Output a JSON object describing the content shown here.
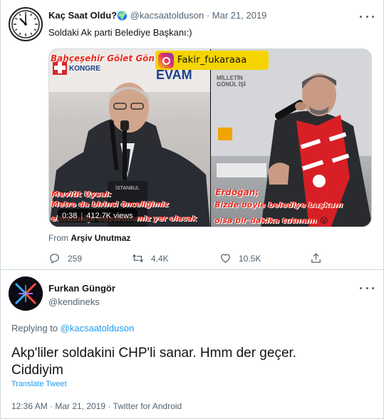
{
  "quoted_tweet": {
    "author_name": "Kaç Saat Oldu?",
    "globe_emoji": "🌍",
    "handle": "@kacsaatolduson",
    "separator": "·",
    "date": "Mar 21, 2019",
    "text": "Soldaki Ak parti Belediye Başkanı:)",
    "media": {
      "left_overlay_top": "Bahçeşehir Gölet Gön",
      "left_sign_1": "KONGRE",
      "left_sign_2": "EVAM",
      "left_caption_name": "Mevlüt Uysal:",
      "left_caption_line1": "Metro da birinci önceliğimiz",
      "left_caption_line2": "ekonomiyi düzeltmemiz yer olacak",
      "podium_label": "İSTANBUL",
      "right_caption_name": "Erdoğan;",
      "right_caption_line1": "Bizde böyle belediye başkanı",
      "right_caption_line2": "olsa bir dakika tutmam",
      "right_emoji": "😮",
      "right_sign": "GÖNÜL İŞİ",
      "instagram_handle": "Fakir_fukaraaa",
      "video_duration": "0:38",
      "video_views": "412.7K views"
    },
    "source": "Arşiv Unutmaz",
    "actions": {
      "reply_count": "259",
      "retweet_count": "4.4K",
      "like_count": "10.5K"
    }
  },
  "reply": {
    "author_name": "Furkan Güngör",
    "handle": "@kendineks",
    "replying_to_label": "Replying to",
    "replying_to_handle": "@kacsaatolduson",
    "text_line1": "Akp'liler soldakini CHP'li sanar. Hmm der geçer.",
    "text_line2": "Ciddiyim",
    "translate_label": "Translate Tweet",
    "timestamp": "12:36 AM · Mar 21, 2019 · Twitter for Android"
  },
  "icons": [
    "clock-avatar-icon",
    "globe-icon",
    "more-icon",
    "reply-icon",
    "retweet-icon",
    "like-icon",
    "share-icon",
    "instagram-icon"
  ],
  "colors": {
    "accent": "#1d9bf0",
    "muted": "#536471",
    "text": "#0f1419",
    "overlay_red": "#e62a1f",
    "badge_yellow": "#f5d400"
  }
}
